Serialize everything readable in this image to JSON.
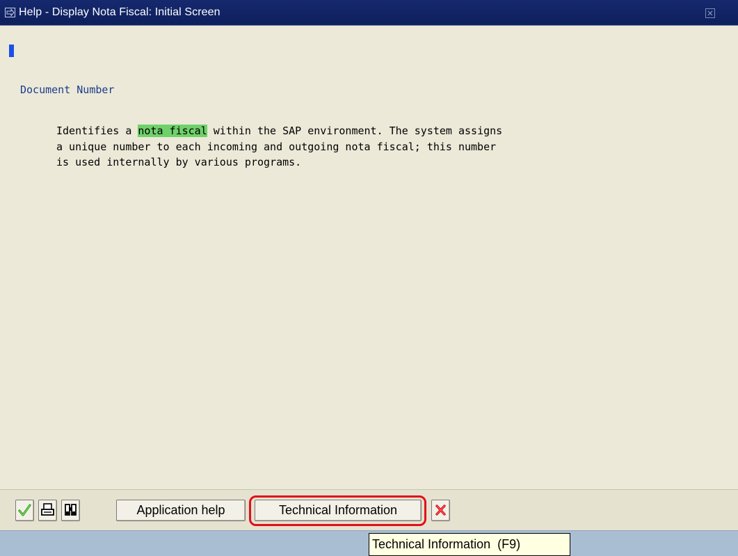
{
  "window": {
    "title": "Help - Display Nota Fiscal: Initial Screen",
    "icons": {
      "title": "help-arrow-icon",
      "close": "close-box-icon"
    }
  },
  "document": {
    "heading": "Document Number",
    "body": {
      "prefix": "Identifies a ",
      "highlight": "nota fiscal",
      "suffix": " within the SAP environment. The system assigns\na unique number to each incoming and outgoing nota fiscal; this number\nis used internally by various programs."
    },
    "highlight_color": "#6fd16a"
  },
  "toolbar": {
    "continue_icon": "checkmark-icon",
    "print_icon": "printer-icon",
    "find_icon": "binoculars-icon",
    "application_help_label": "Application help",
    "technical_info_label": "Technical Information",
    "cancel_icon": "cancel-x-icon",
    "accent_ring_color": "#e0101a"
  },
  "tooltip": {
    "text": "Technical Information  (F9)"
  }
}
